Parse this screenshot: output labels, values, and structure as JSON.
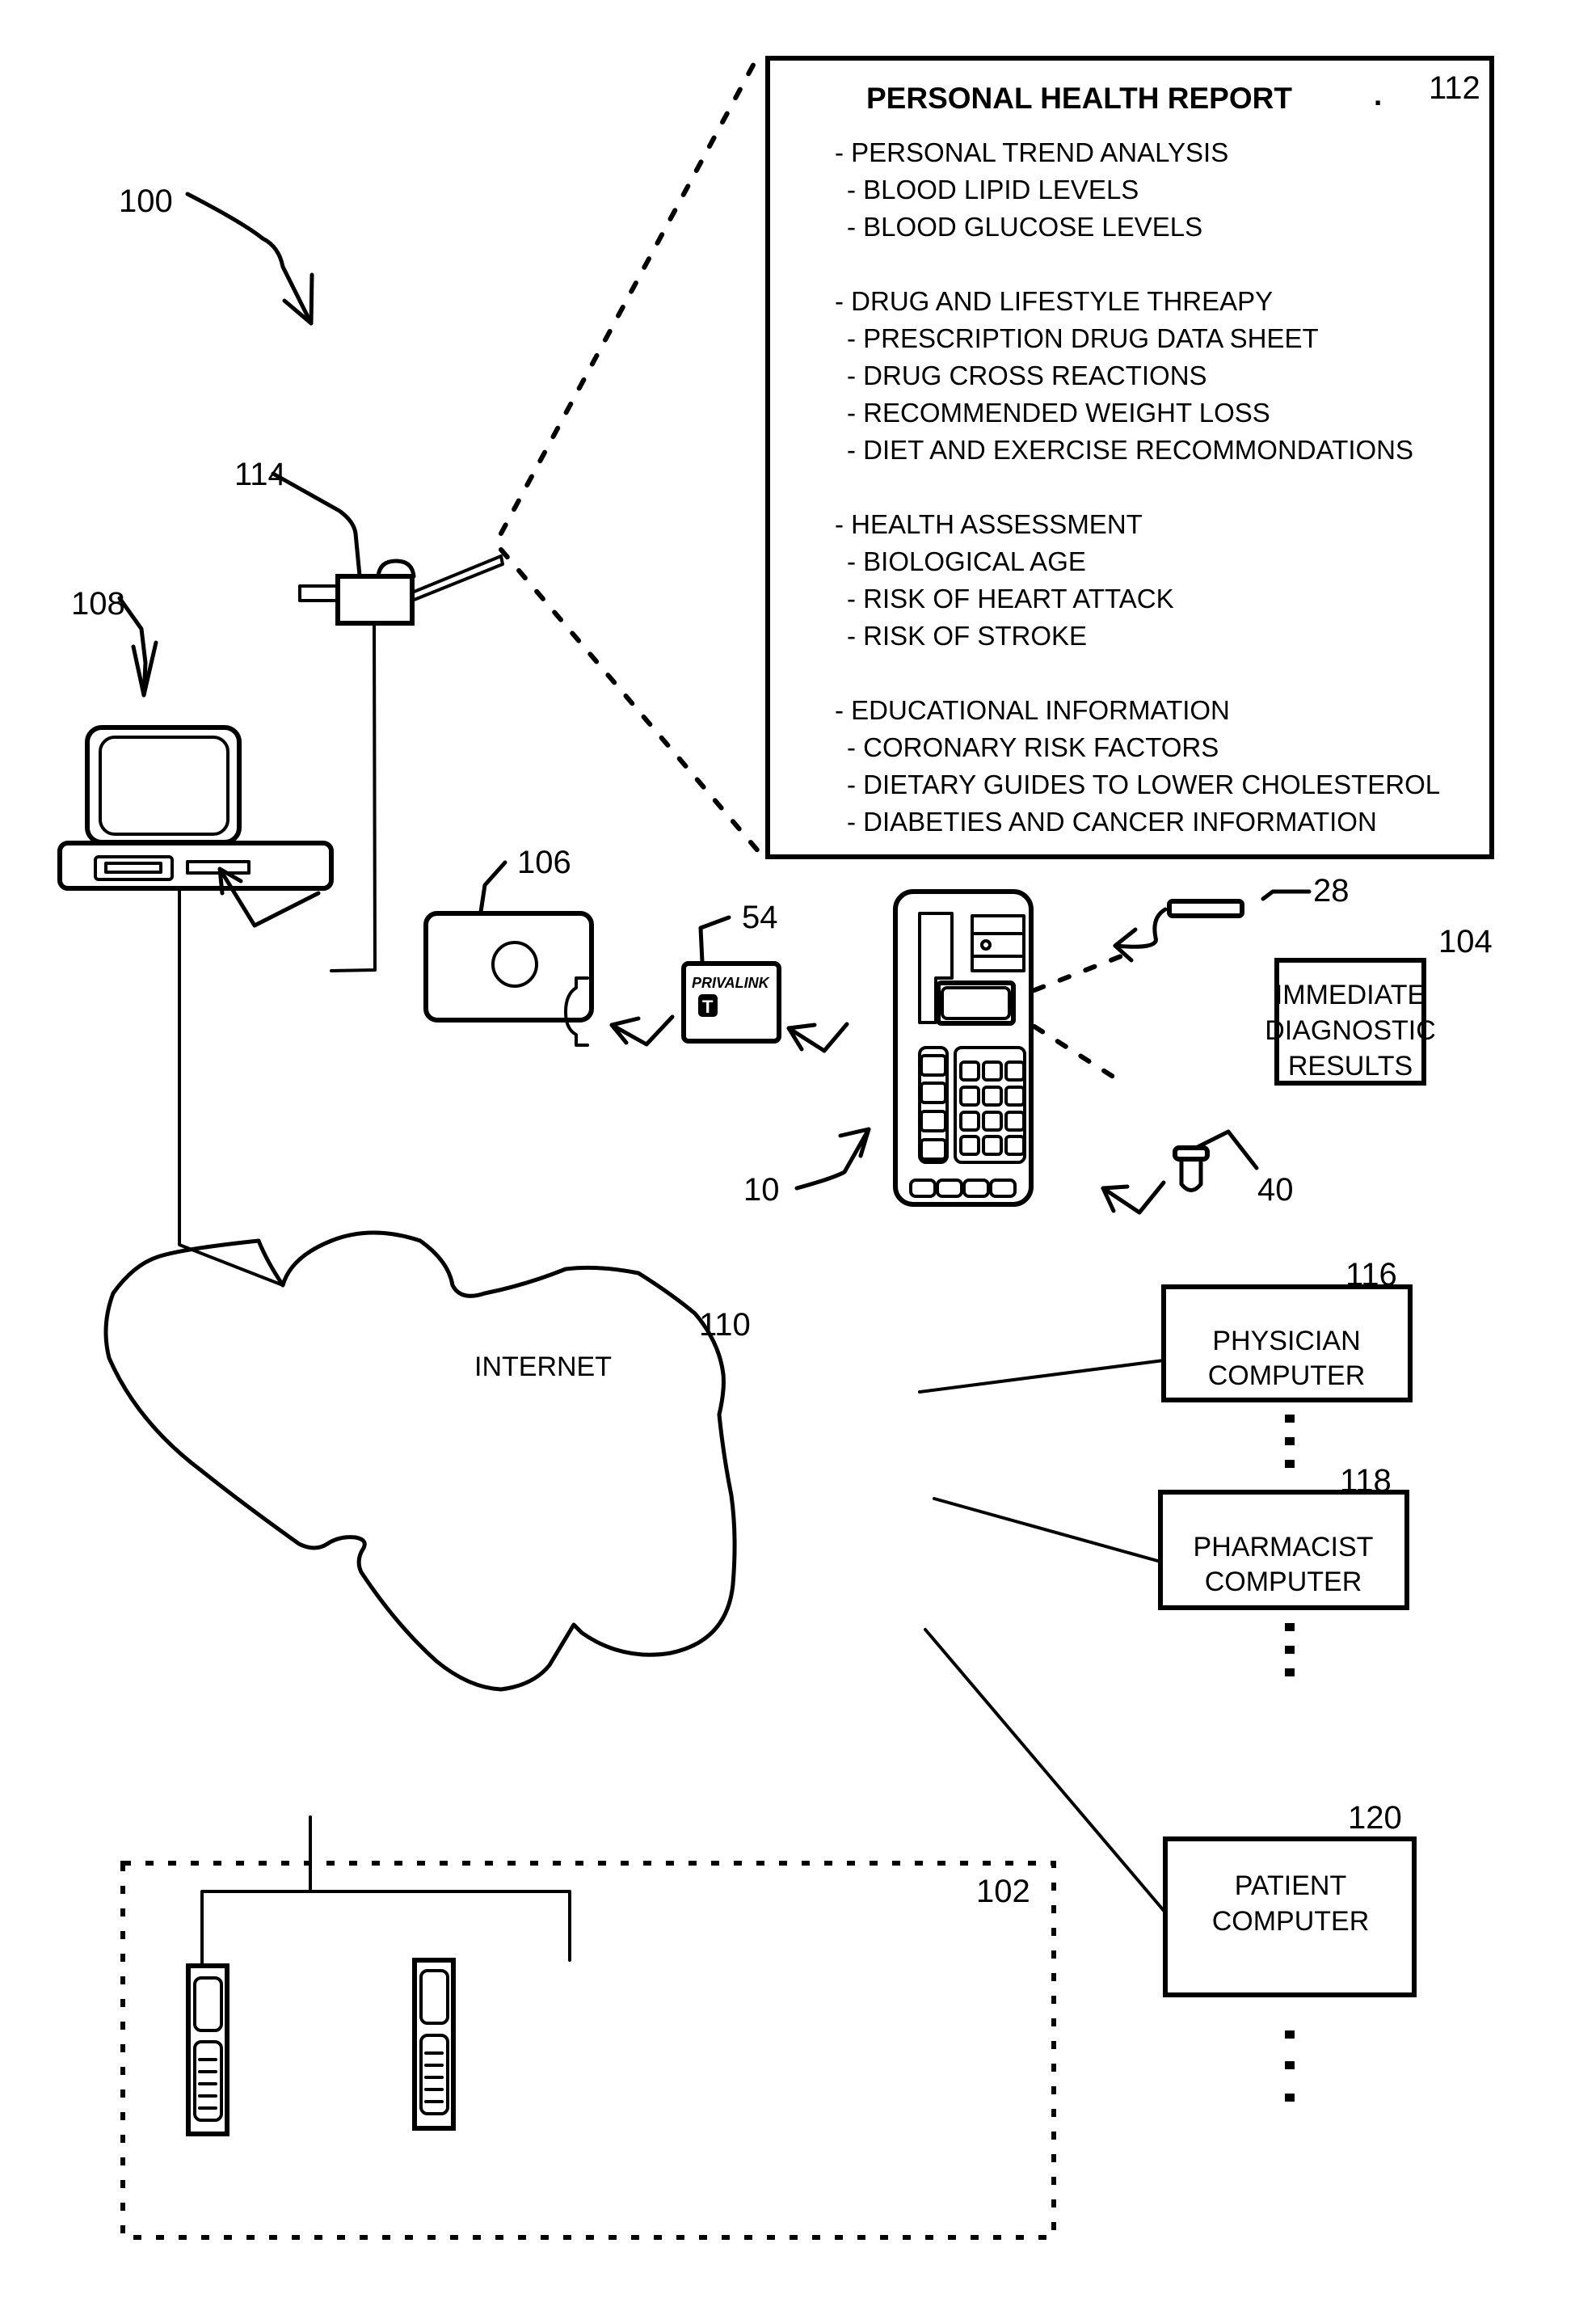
{
  "figure": {
    "refs": {
      "system": "100",
      "local_network": "102",
      "diagnostic_results": "104",
      "card_reader": "106",
      "home_computer": "108",
      "internet": "110",
      "health_report": "112",
      "device_114": "114",
      "physician": "116",
      "pharmacist": "118",
      "patient": "120",
      "test_strip": "28",
      "sample_vial": "40",
      "smart_card": "54",
      "meter": "10"
    },
    "health_report": {
      "title": "PERSONAL HEALTH REPORT",
      "title_mark": ".",
      "sections": [
        {
          "heading": "- PERSONAL TREND ANALYSIS",
          "items": [
            "- BLOOD LIPID LEVELS",
            "- BLOOD GLUCOSE LEVELS"
          ]
        },
        {
          "heading": "- DRUG AND LIFESTYLE THREAPY",
          "items": [
            "- PRESCRIPTION DRUG DATA SHEET",
            "- DRUG CROSS REACTIONS",
            "- RECOMMENDED WEIGHT LOSS",
            "- DIET AND EXERCISE RECOMMONDATIONS"
          ]
        },
        {
          "heading": "- HEALTH ASSESSMENT",
          "items": [
            "- BIOLOGICAL AGE",
            "- RISK OF HEART ATTACK",
            "- RISK OF STROKE"
          ]
        },
        {
          "heading": "- EDUCATIONAL INFORMATION",
          "items": [
            "- CORONARY RISK FACTORS",
            "- DIETARY GUIDES TO LOWER CHOLESTEROL",
            "- DIABETIES AND CANCER INFORMATION"
          ]
        }
      ]
    },
    "diagnostic_box": {
      "lines": [
        "IMMEDIATE",
        "DIAGNOSTIC",
        "RESULTS"
      ]
    },
    "smart_card": {
      "brand": "PRIVALINK",
      "glyph": "T"
    },
    "internet_label": "INTERNET",
    "computers": [
      {
        "lines": [
          "PHYSICIAN",
          "COMPUTER"
        ]
      },
      {
        "lines": [
          "PHARMACIST",
          "COMPUTER"
        ]
      },
      {
        "lines": [
          "PATIENT",
          "COMPUTER"
        ]
      }
    ]
  }
}
